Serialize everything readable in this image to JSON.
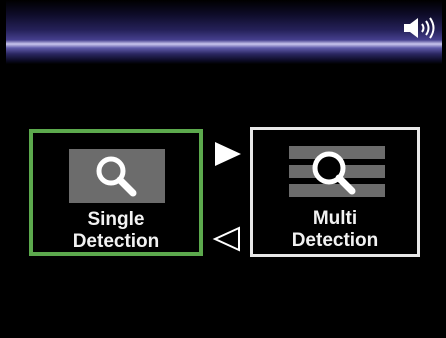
{
  "status_bar": {
    "audio_icon": "speaker-on-icon"
  },
  "detection_modes": {
    "single": {
      "line1": "Single",
      "line2": "Detection",
      "selected": true,
      "highlight_color": "#5ca94d",
      "icon": "magnifier-icon"
    },
    "multi": {
      "line1": "Multi",
      "line2": "Detection",
      "selected": false,
      "border_color": "#e8e8e8",
      "icon": "magnifier-multi-list-icon"
    }
  },
  "navigation": {
    "next_icon": "arrow-right-filled-icon",
    "prev_icon": "arrow-left-outline-icon"
  }
}
